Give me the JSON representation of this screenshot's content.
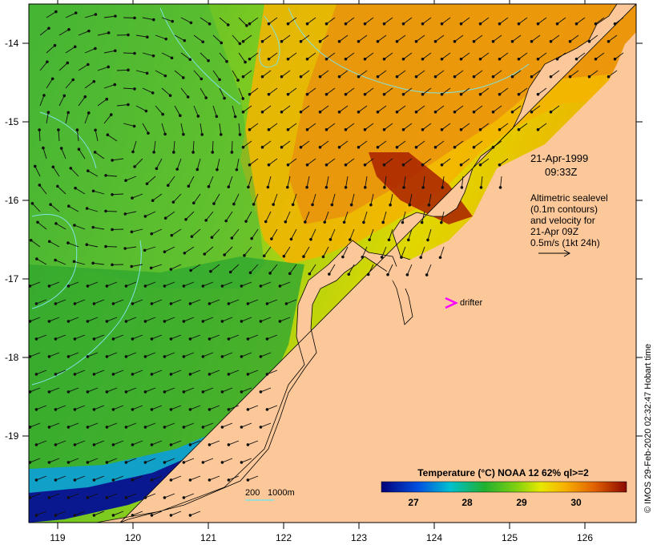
{
  "map": {
    "y_ticks": [
      "-14",
      "-15",
      "-16",
      "-17",
      "-18",
      "-19"
    ],
    "x_ticks": [
      "119",
      "120",
      "121",
      "122",
      "123",
      "124",
      "125",
      "126"
    ],
    "date": "21-Apr-1999",
    "time": "09:33Z",
    "legend_lines": [
      "Altimetric sealevel",
      "(0.1m contours)",
      "and velocity for",
      "21-Apr 09Z",
      "0.5m/s (1kt 24h)"
    ],
    "drifter_label": "drifter",
    "depth_label_a": "200",
    "depth_label_b": "1000m",
    "credit": "© IMOS 29-Feb-2020 02:32:47 Hobart time",
    "colorbar_title": "Temperature (°C) NOAA 12 62% ql>=2",
    "colorbar_ticks": [
      "27",
      "28",
      "29",
      "30"
    ],
    "colors": {
      "land": "#fcc89a",
      "drifter": "#ff00ff",
      "contour": "#7fe3e3",
      "arrow": "#111111"
    }
  }
}
